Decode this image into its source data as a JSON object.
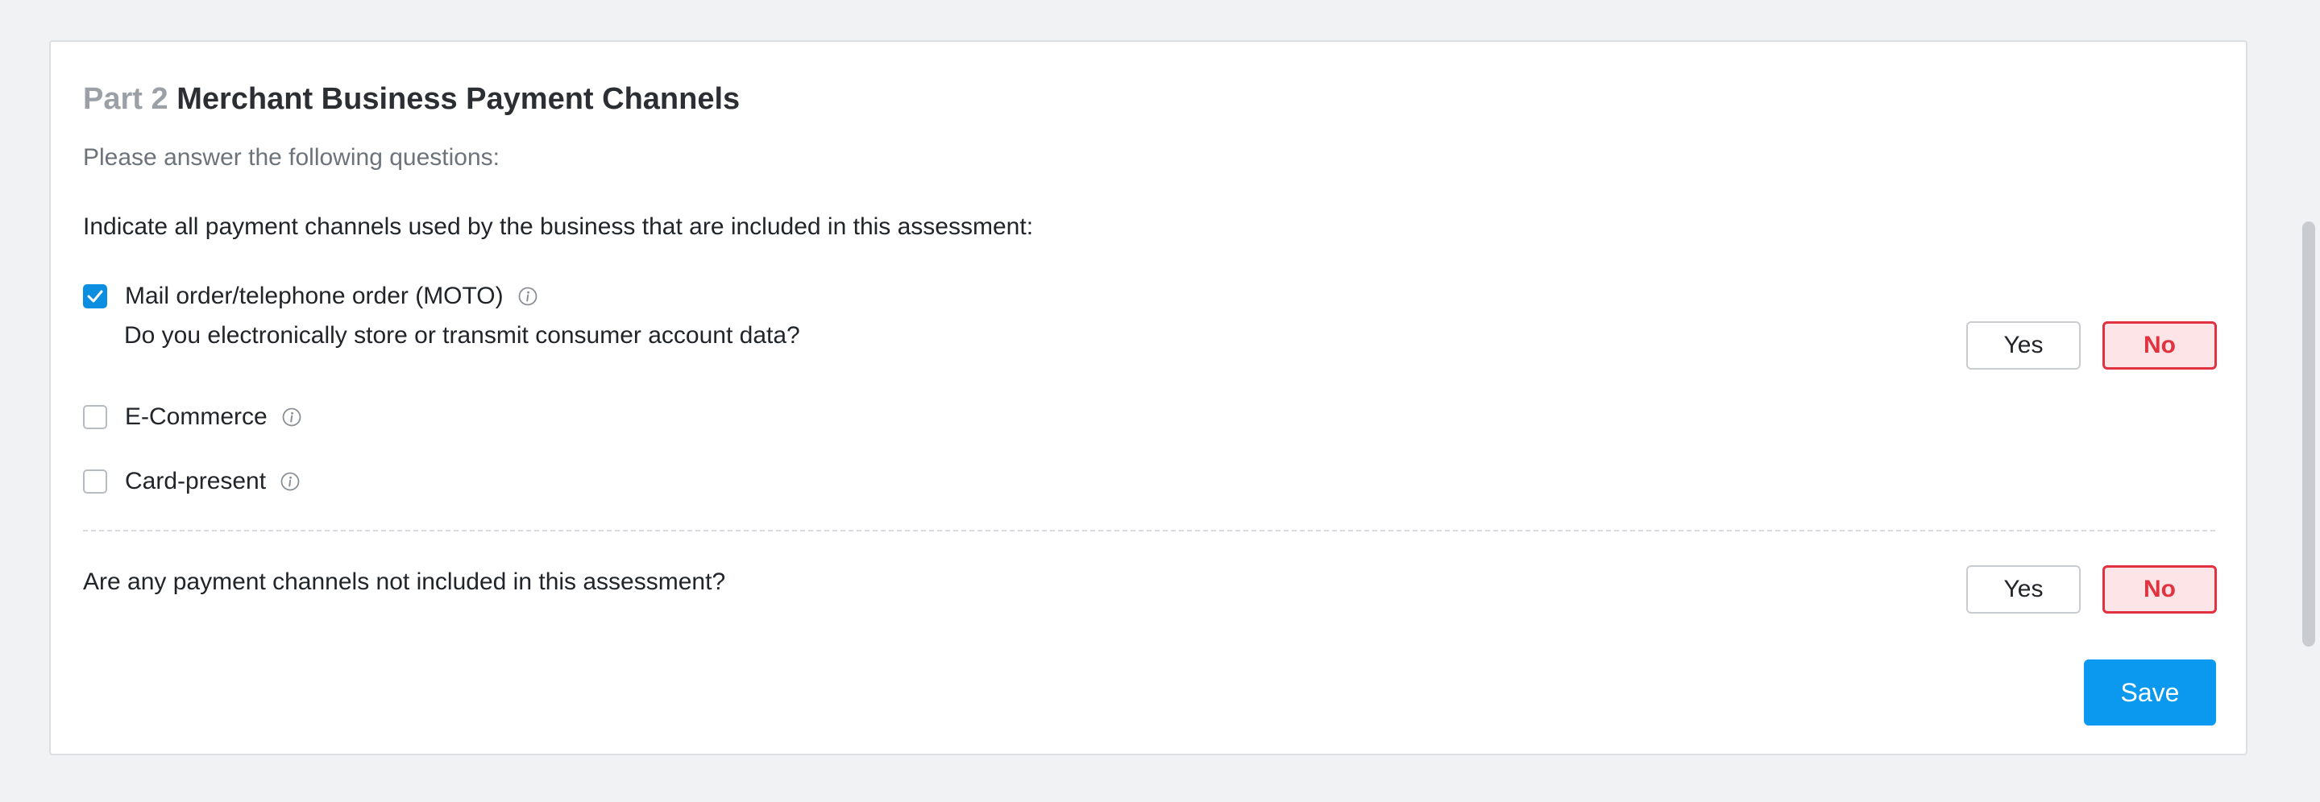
{
  "section": {
    "part_label": "Part 2",
    "title": "Merchant Business Payment Channels",
    "subtitle": "Please answer the following questions:"
  },
  "channels_question": "Indicate all payment channels used by the business that are included in this assessment:",
  "channels": [
    {
      "label": "Mail order/telephone order (MOTO)",
      "checked": true,
      "info_icon": "info-icon",
      "sub_question": {
        "text": "Do you electronically store or transmit consumer account data?",
        "yes_label": "Yes",
        "no_label": "No",
        "selected": "No"
      }
    },
    {
      "label": "E-Commerce",
      "checked": false,
      "info_icon": "info-icon"
    },
    {
      "label": "Card-present",
      "checked": false,
      "info_icon": "info-icon"
    }
  ],
  "excluded_question": {
    "text": "Are any payment channels not included in this assessment?",
    "yes_label": "Yes",
    "no_label": "No",
    "selected": "No"
  },
  "actions": {
    "save_label": "Save"
  },
  "colors": {
    "accent": "#0b99f0",
    "checkbox_checked": "#0b8ee0",
    "selected_no_border": "#e0333f",
    "selected_no_fill": "#fde4e6"
  }
}
